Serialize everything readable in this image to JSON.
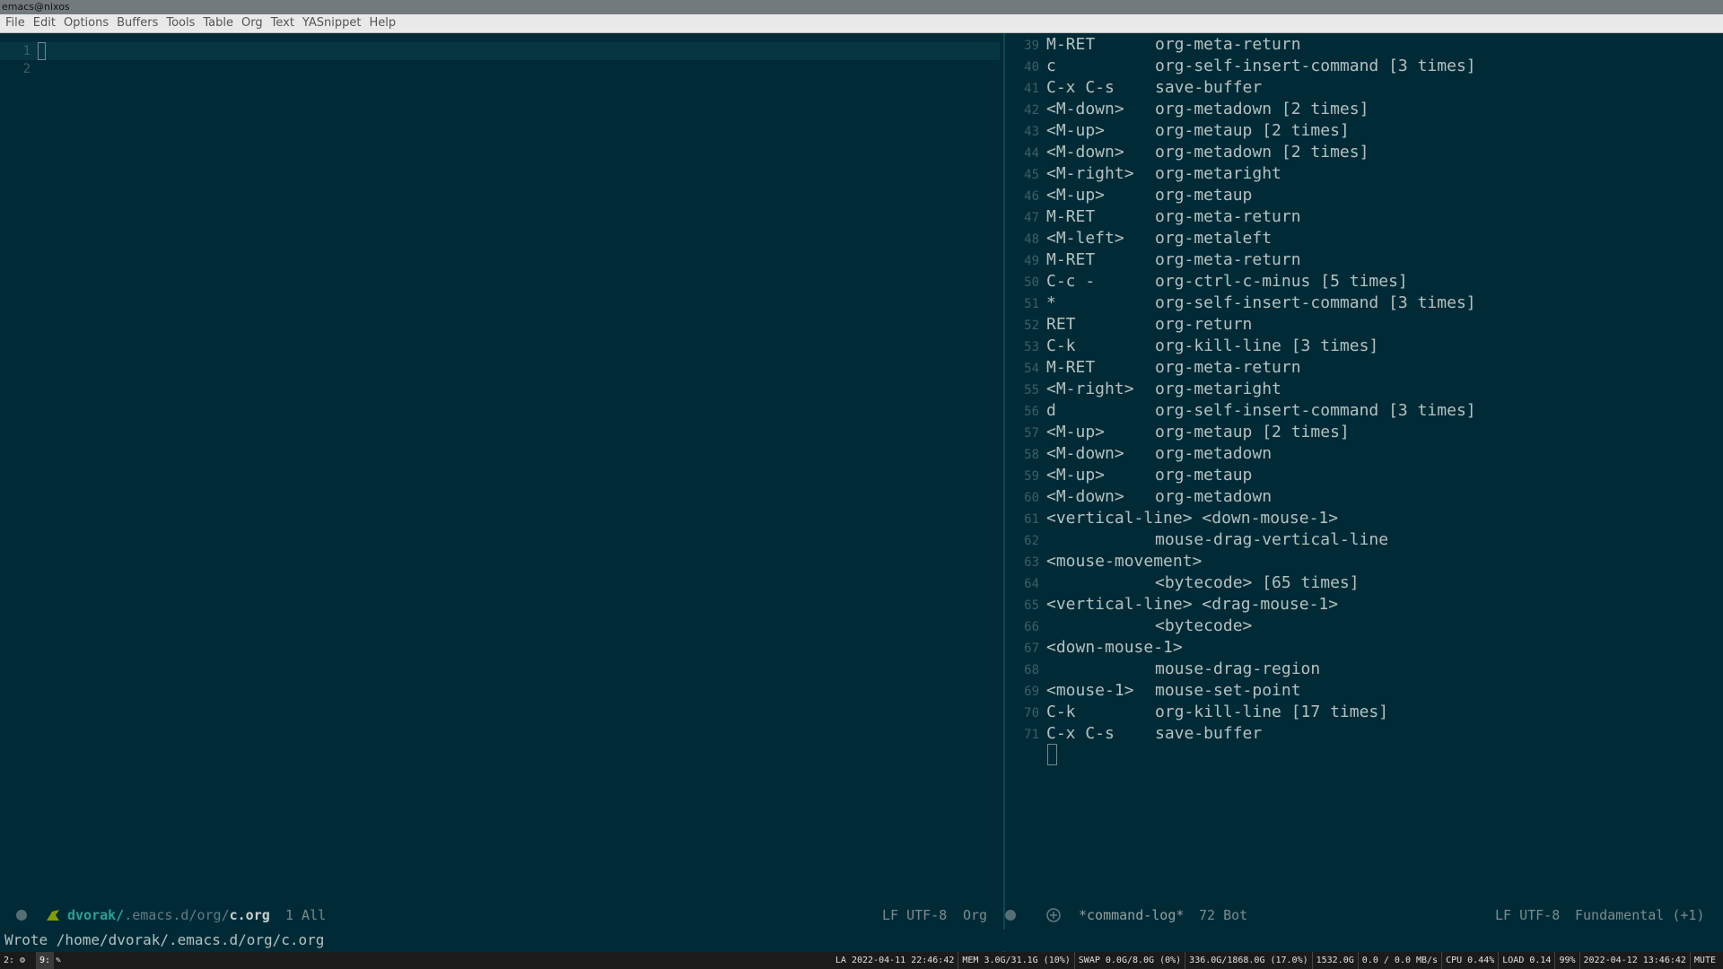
{
  "window": {
    "title": "emacs@nixos"
  },
  "menu": [
    "File",
    "Edit",
    "Options",
    "Buffers",
    "Tools",
    "Table",
    "Org",
    "Text",
    "YASnippet",
    "Help"
  ],
  "left_buffer": {
    "line_numbers": [
      "1",
      "2"
    ],
    "modeline": {
      "path_user": "dvorak/",
      "path_dir": ".emacs.d/org/",
      "path_file": "c.org",
      "position": "1 All",
      "encoding": "LF UTF-8",
      "mode": "Org"
    }
  },
  "right_buffer": {
    "lines": [
      {
        "n": "39",
        "key": "M-RET",
        "cmd": "org-meta-return"
      },
      {
        "n": "40",
        "key": "c",
        "cmd": "org-self-insert-command [3 times]"
      },
      {
        "n": "41",
        "key": "C-x C-s",
        "cmd": "save-buffer"
      },
      {
        "n": "42",
        "key": "<M-down>",
        "cmd": "org-metadown [2 times]"
      },
      {
        "n": "43",
        "key": "<M-up>",
        "cmd": "org-metaup [2 times]"
      },
      {
        "n": "44",
        "key": "<M-down>",
        "cmd": "org-metadown [2 times]"
      },
      {
        "n": "45",
        "key": "<M-right>",
        "cmd": "org-metaright"
      },
      {
        "n": "46",
        "key": "<M-up>",
        "cmd": "org-metaup"
      },
      {
        "n": "47",
        "key": "M-RET",
        "cmd": "org-meta-return"
      },
      {
        "n": "48",
        "key": "<M-left>",
        "cmd": "org-metaleft"
      },
      {
        "n": "49",
        "key": "M-RET",
        "cmd": "org-meta-return"
      },
      {
        "n": "50",
        "key": "C-c -",
        "cmd": "org-ctrl-c-minus [5 times]"
      },
      {
        "n": "51",
        "key": "*",
        "cmd": "org-self-insert-command [3 times]"
      },
      {
        "n": "52",
        "key": "RET",
        "cmd": "org-return"
      },
      {
        "n": "53",
        "key": "C-k",
        "cmd": "org-kill-line [3 times]"
      },
      {
        "n": "54",
        "key": "M-RET",
        "cmd": "org-meta-return"
      },
      {
        "n": "55",
        "key": "<M-right>",
        "cmd": "org-metaright"
      },
      {
        "n": "56",
        "key": "d",
        "cmd": "org-self-insert-command [3 times]"
      },
      {
        "n": "57",
        "key": "<M-up>",
        "cmd": "org-metaup [2 times]"
      },
      {
        "n": "58",
        "key": "<M-down>",
        "cmd": "org-metadown"
      },
      {
        "n": "59",
        "key": "<M-up>",
        "cmd": "org-metaup"
      },
      {
        "n": "60",
        "key": "<M-down>",
        "cmd": "org-metadown"
      },
      {
        "n": "61",
        "key": "<vertical-line> <down-mouse-1>",
        "cmd": ""
      },
      {
        "n": "62",
        "key": "",
        "cmd": "mouse-drag-vertical-line"
      },
      {
        "n": "63",
        "key": "<mouse-movement>",
        "cmd": ""
      },
      {
        "n": "64",
        "key": "",
        "cmd": "<bytecode> [65 times]"
      },
      {
        "n": "65",
        "key": "<vertical-line> <drag-mouse-1>",
        "cmd": ""
      },
      {
        "n": "66",
        "key": "",
        "cmd": "<bytecode>"
      },
      {
        "n": "67",
        "key": "<down-mouse-1>",
        "cmd": ""
      },
      {
        "n": "68",
        "key": "",
        "cmd": "mouse-drag-region"
      },
      {
        "n": "69",
        "key": "<mouse-1>",
        "cmd": "mouse-set-point"
      },
      {
        "n": "70",
        "key": "C-k",
        "cmd": "org-kill-line [17 times]"
      },
      {
        "n": "71",
        "key": "C-x C-s",
        "cmd": "save-buffer"
      }
    ],
    "modeline": {
      "buffer_name": "*command-log*",
      "position": "72 Bot",
      "encoding": "LF UTF-8",
      "mode": "Fundamental (+1)"
    }
  },
  "echo_area": "Wrote /home/dvorak/.emacs.d/org/c.org",
  "statusbar": {
    "workspaces": [
      "2:",
      "9:"
    ],
    "segments": [
      "LA 2022-04-11 22:46:42",
      "MEM 3.0G/31.1G (10%)",
      "SWAP 0.0G/8.0G (0%)",
      "336.0G/1868.0G (17.0%)",
      "1532.0G",
      "0.0  /  0.0 MB/s",
      "CPU 0.44%",
      "LOAD 0.14",
      "99%",
      "2022-04-12 13:46:42",
      "MUTE"
    ]
  }
}
